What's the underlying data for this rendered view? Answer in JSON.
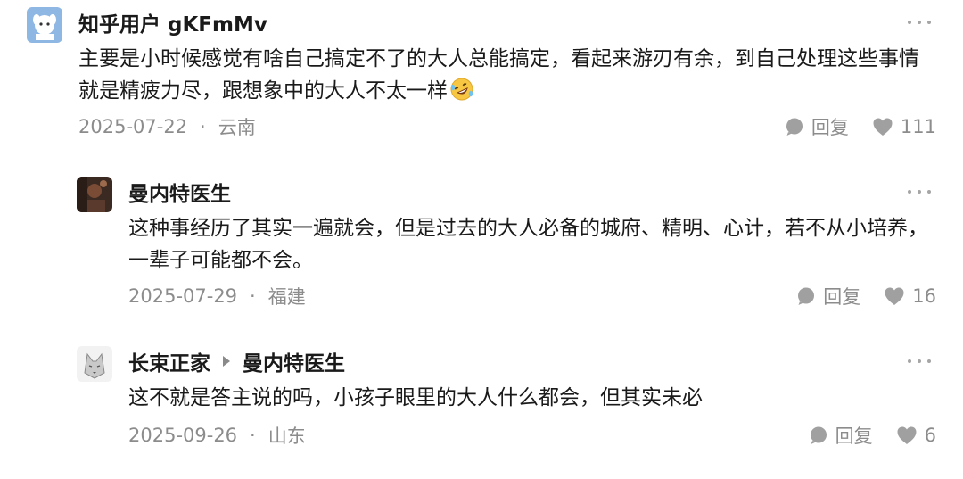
{
  "comments": [
    {
      "author": "知乎用户 gKFmMv",
      "text": "主要是小时候感觉有啥自己搞定不了的大人总能搞定，看起来游刃有余，到自己处理这些事情就是精疲力尽，跟想象中的大人不太一样",
      "emoji": "rolling-on-floor-laughing-emoji",
      "date": "2025-07-22",
      "separator": "·",
      "location": "云南",
      "reply_label": "回复",
      "likes": "111",
      "avatar_icon": "cartoon-character-avatar"
    },
    {
      "author": "曼内特医生",
      "text": "这种事经历了其实一遍就会，但是过去的大人必备的城府、精明、心计，若不从小培养，一辈子可能都不会。",
      "date": "2025-07-29",
      "separator": "·",
      "location": "福建",
      "reply_label": "回复",
      "likes": "16",
      "avatar_icon": "dark-photo-avatar"
    },
    {
      "author": "长束正家",
      "reply_to": "曼内特医生",
      "text": "这不就是答主说的吗，小孩子眼里的大人什么都会，但其实未必",
      "date": "2025-09-26",
      "separator": "·",
      "location": "山东",
      "reply_label": "回复",
      "likes": "6",
      "avatar_icon": "wolf-sketch-avatar"
    }
  ],
  "colors": {
    "text_primary": "#1a1a1a",
    "text_secondary": "#8c8c8c",
    "icon_gray": "#a0a0a0"
  }
}
